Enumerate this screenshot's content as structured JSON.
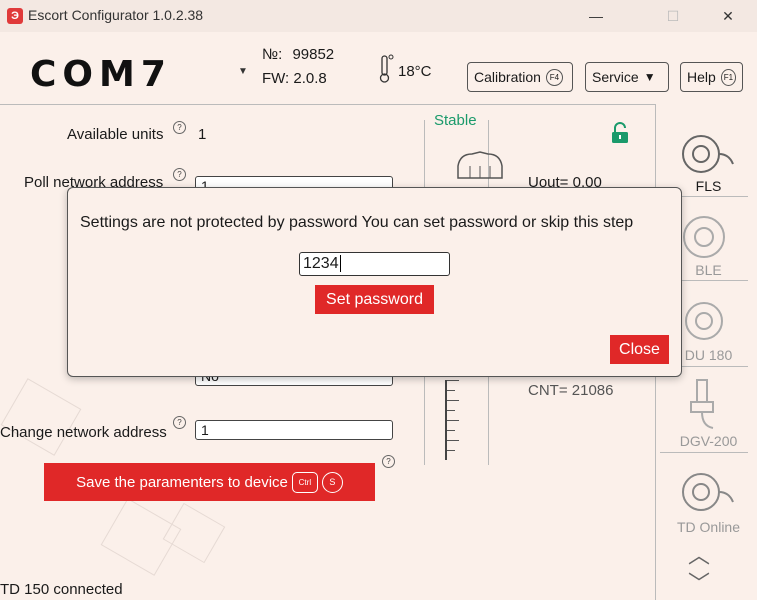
{
  "window": {
    "title": "Escort Configurator 1.0.2.38",
    "app_icon": "Э",
    "minimize": "—",
    "maximize": "☐",
    "close": "✕"
  },
  "header": {
    "port": "COM7",
    "serial_label": "№:",
    "serial_value": "99852",
    "fw_label": "FW:",
    "fw_value": "2.0.8",
    "temperature": "18°C",
    "calibration_label": "Calibration",
    "calibration_key": "F4",
    "service_label": "Service",
    "help_label": "Help",
    "help_key": "F1"
  },
  "form": {
    "available_units_label": "Available units",
    "available_units_value": "1",
    "poll_address_label": "Poll network address",
    "poll_address_value": "1",
    "hidden_select_value": "No",
    "change_address_label": "Change network address",
    "change_address_value": "1",
    "help_glyph": "?",
    "save_label": "Save the paramenters to device",
    "save_key1": "Ctrl",
    "save_key2": "S"
  },
  "sensor": {
    "state": "Stable",
    "uout": "Uout=   0.00",
    "cnt": "CNT= 21086"
  },
  "status": {
    "text": "TD 150 connected"
  },
  "sidebar": {
    "items": [
      {
        "label": "FLS"
      },
      {
        "label": "BLE"
      },
      {
        "label": "DU 180"
      },
      {
        "label": "DGV-200"
      },
      {
        "label": "TD Online"
      }
    ],
    "up": "︿",
    "down": "﹀"
  },
  "dialog": {
    "message": "Settings are not protected by password You can set password or skip this step",
    "password_value": "1234",
    "set_password_label": "Set password",
    "close_label": "Close"
  },
  "colors": {
    "accent_red": "#e02828",
    "stable_green": "#1a9a6b",
    "background": "#fbf0ea"
  }
}
